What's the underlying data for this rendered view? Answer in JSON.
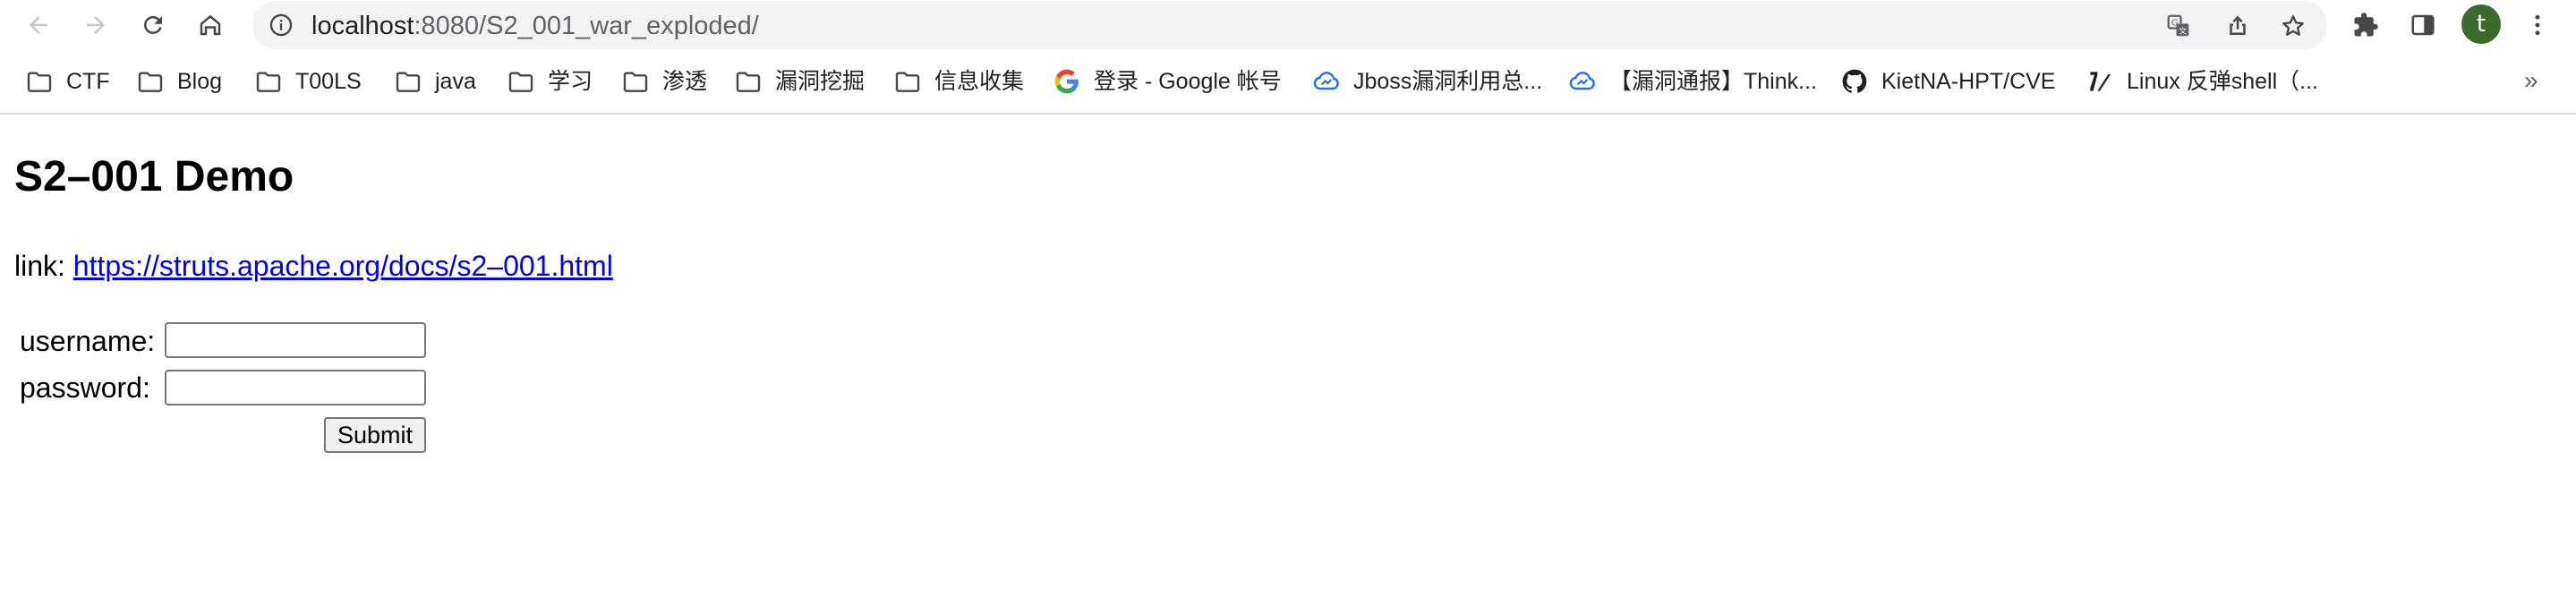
{
  "browser": {
    "url_host": "localhost",
    "url_rest": ":8080/S2_001_war_exploded/",
    "avatar_letter": "t",
    "avatar_color": "#3a6b2c"
  },
  "bookmarks": [
    {
      "label": "CTF",
      "icon": "folder-icon"
    },
    {
      "label": "Blog",
      "icon": "folder-icon"
    },
    {
      "label": "T00LS",
      "icon": "folder-icon"
    },
    {
      "label": "java",
      "icon": "folder-icon"
    },
    {
      "label": "学习",
      "icon": "folder-icon"
    },
    {
      "label": "渗透",
      "icon": "folder-icon"
    },
    {
      "label": "漏洞挖掘",
      "icon": "folder-icon"
    },
    {
      "label": "信息收集",
      "icon": "folder-icon"
    },
    {
      "label": "登录 - Google 帐号",
      "icon": "google-icon"
    },
    {
      "label": "Jboss漏洞利用总...",
      "icon": "cloud-icon"
    },
    {
      "label": "【漏洞通报】Think...",
      "icon": "cloud-icon"
    },
    {
      "label": "KietNA-HPT/CVE",
      "icon": "github-icon"
    },
    {
      "label": "Linux 反弹shell（...",
      "icon": "zhihu-icon"
    }
  ],
  "bookmarks_more": "»",
  "page": {
    "title": "S2–001 Demo",
    "link_prefix": "link: ",
    "link_text": "https://struts.apache.org/docs/s2–001.html",
    "username_label": "username:",
    "password_label": "password:",
    "username_value": "",
    "password_value": "",
    "submit_label": "Submit"
  }
}
